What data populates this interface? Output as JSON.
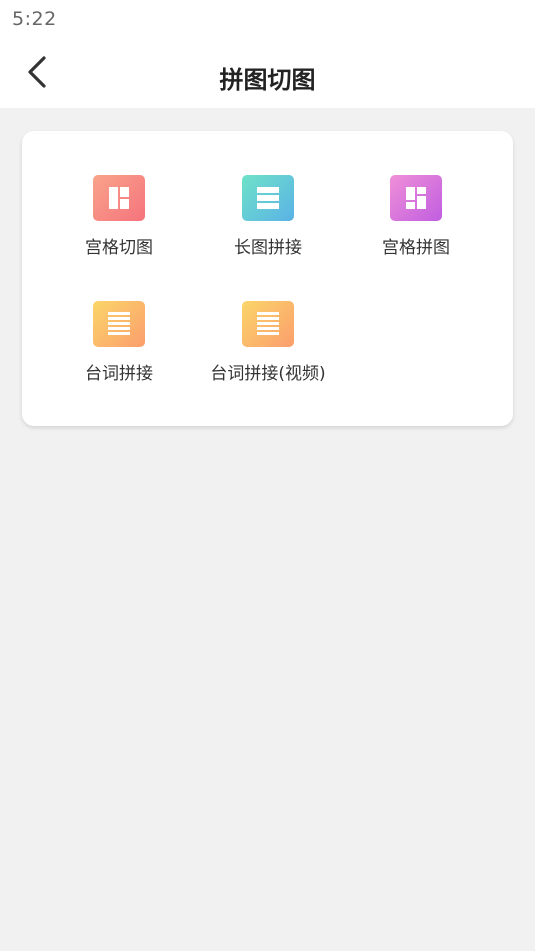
{
  "status_bar": {
    "time": "5:22"
  },
  "header": {
    "title": "拼图切图",
    "back_icon": "chevron-left-icon"
  },
  "tools": [
    {
      "label": "宫格切图",
      "icon": "grid-layout-icon",
      "color": "#f5737d"
    },
    {
      "label": "长图拼接",
      "icon": "stacked-rows-icon",
      "color": "#5ab2e6"
    },
    {
      "label": "宫格拼图",
      "icon": "grid-collage-icon",
      "color": "#c05ee0"
    },
    {
      "label": "台词拼接",
      "icon": "subtitle-lines-icon",
      "color": "#fb9e6c"
    },
    {
      "label": "台词拼接(视频)",
      "icon": "subtitle-lines-video-icon",
      "color": "#fb9e6c"
    }
  ]
}
